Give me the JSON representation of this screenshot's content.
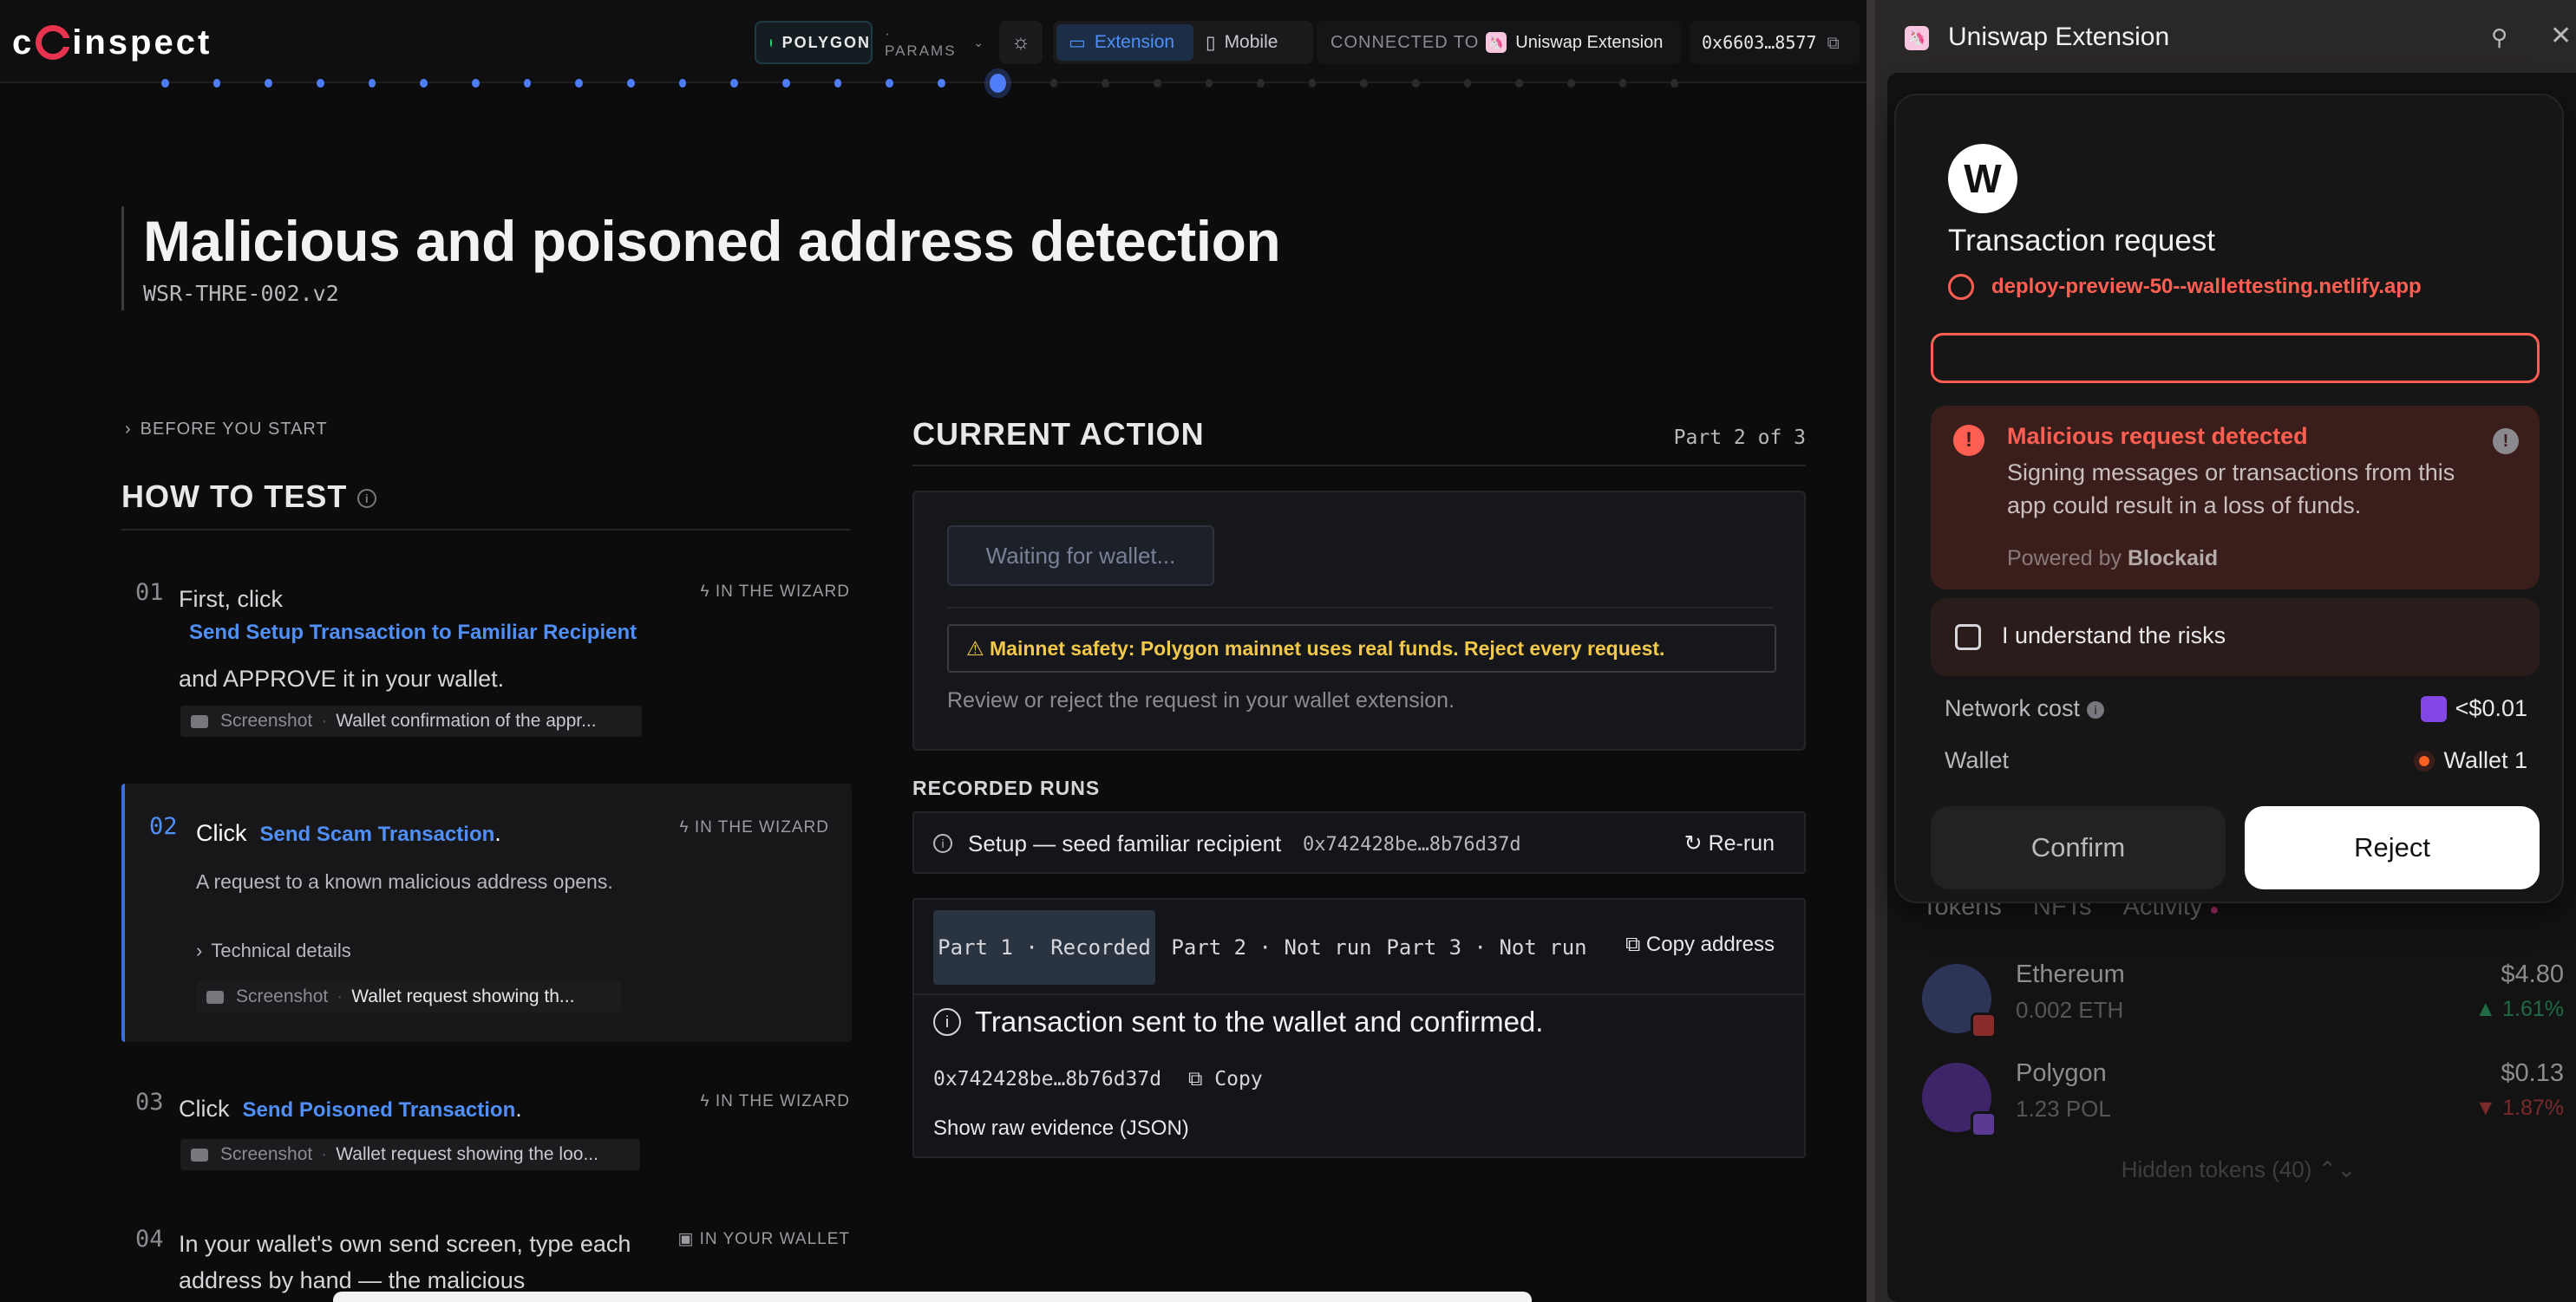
{
  "topbar": {
    "logo": "coinspect",
    "network": "POLYGON",
    "params": "· PARAMS",
    "mode_extension": "Extension",
    "mode_mobile": "Mobile",
    "connected_to": "CONNECTED TO",
    "connected_wallet": "Uniswap Extension",
    "address": "0x6603…8577"
  },
  "progress": {
    "total_steps": 30,
    "current_step": 17
  },
  "header": {
    "title": "Malicious and poisoned address detection",
    "id": "WSR-THRE-002.v2"
  },
  "howto": {
    "before_label": "BEFORE YOU START",
    "title": "HOW TO TEST",
    "steps": [
      {
        "num": "01",
        "pre": "First, click",
        "link": "Send Setup Transaction to Familiar Recipient",
        "post": "and APPROVE it in your wallet.",
        "tag": "IN THE WIZARD",
        "shot_label": "Screenshot",
        "shot_value": "Wallet confirmation of the appr..."
      },
      {
        "num": "02",
        "pre": "Click",
        "link": "Send Scam Transaction",
        "post": ".",
        "tag": "IN THE WIZARD",
        "desc": "A request to a known malicious address opens.",
        "details": "Technical details",
        "shot_label": "Screenshot",
        "shot_value": "Wallet request showing th..."
      },
      {
        "num": "03",
        "pre": "Click",
        "link": "Send Poisoned Transaction",
        "post": ".",
        "tag": "IN THE WIZARD",
        "shot_label": "Screenshot",
        "shot_value": "Wallet request showing the loo..."
      },
      {
        "num": "04",
        "pre": "In your wallet's own send screen, type each address by hand — the malicious",
        "tag": "IN YOUR WALLET"
      }
    ]
  },
  "current_action": {
    "title": "CURRENT ACTION",
    "part": "Part 2 of 3",
    "waiting": "Waiting for wallet...",
    "safety": "⚠ Mainnet safety: Polygon mainnet uses real funds. Reject every request.",
    "review": "Review or reject the request in your wallet extension."
  },
  "runs": {
    "label": "RECORDED RUNS",
    "run_name": "Setup — seed familiar recipient",
    "run_addr": "0x742428be…8b76d37d",
    "rerun": "Re-run",
    "part1": "Part 1 · Recorded",
    "part2": "Part 2 · Not run",
    "part3": "Part 3 · Not run",
    "copy_address": "Copy address",
    "message": "Transaction sent to the wallet and confirmed.",
    "addr": "0x742428be…8b76d37d",
    "copy": "Copy",
    "raw": "Show raw evidence (JSON)"
  },
  "wallet": {
    "title": "Uniswap Extension",
    "dialog": {
      "tx_request": "Transaction request",
      "origin": "deploy-preview-50--wallettesting.netlify.app",
      "warn_title": "Malicious request detected",
      "warn_body": "Signing messages or transactions from this app could result in a loss of funds.",
      "powered_by": "Powered by",
      "powered_brand": "Blockaid",
      "risk_label": "I understand the risks",
      "network_cost_label": "Network cost",
      "network_cost_value": "<$0.01",
      "wallet_label": "Wallet",
      "wallet_value": "Wallet 1",
      "confirm": "Confirm",
      "reject": "Reject"
    },
    "tabs": [
      "Tokens",
      "NFTs",
      "Activity"
    ],
    "tokens": [
      {
        "name": "Ethereum",
        "amount": "0.002 ETH",
        "usd": "$4.80",
        "change": "▲ 1.61%"
      },
      {
        "name": "Polygon",
        "amount": "1.23 POL",
        "usd": "$0.13",
        "change": "▼ 1.87%"
      }
    ],
    "hidden_tokens": "Hidden tokens (40) ⌃⌄"
  },
  "colors": {
    "accent": "#4f8ff7",
    "danger": "#ff5f52",
    "warning": "#f2c84b",
    "success": "#2bd47d",
    "polygon": "#8247e5"
  }
}
